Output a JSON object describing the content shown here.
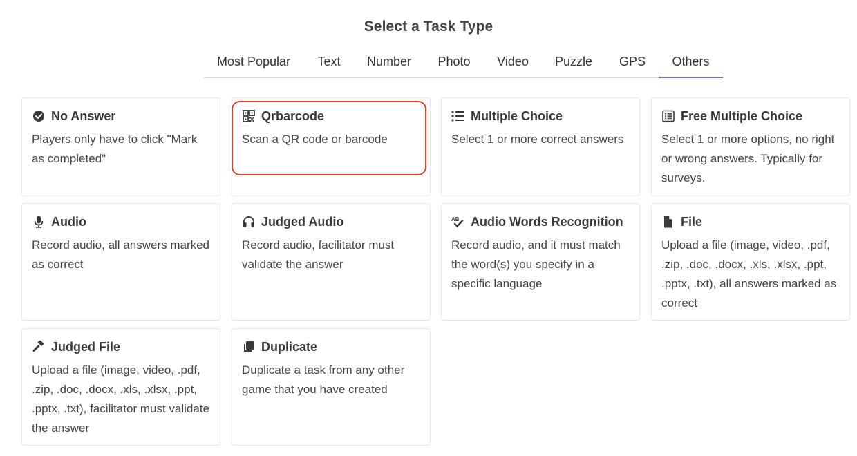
{
  "page": {
    "title": "Select a Task Type"
  },
  "tabs": [
    {
      "label": "Most Popular",
      "active": false
    },
    {
      "label": "Text",
      "active": false
    },
    {
      "label": "Number",
      "active": false
    },
    {
      "label": "Photo",
      "active": false
    },
    {
      "label": "Video",
      "active": false
    },
    {
      "label": "Puzzle",
      "active": false
    },
    {
      "label": "GPS",
      "active": false
    },
    {
      "label": "Others",
      "active": true
    }
  ],
  "cards": [
    {
      "title": "No Answer",
      "description": "Players only have to click \"Mark as completed\"",
      "icon": "check-circle-icon"
    },
    {
      "title": "Qrbarcode",
      "description": "Scan a QR code or barcode",
      "icon": "qrcode-icon",
      "highlighted": true
    },
    {
      "title": "Multiple Choice",
      "description": "Select 1 or more correct answers",
      "icon": "list-icon"
    },
    {
      "title": "Free Multiple Choice",
      "description": "Select 1 or more options, no right or wrong answers. Typically for surveys.",
      "icon": "list-box-icon"
    },
    {
      "title": "Audio",
      "description": "Record audio, all answers marked as correct",
      "icon": "microphone-icon"
    },
    {
      "title": "Judged Audio",
      "description": "Record audio, facilitator must validate the answer",
      "icon": "headphones-icon"
    },
    {
      "title": "Audio Words Recognition",
      "description": "Record audio, and it must match the word(s) you specify in a specific language",
      "icon": "spellcheck-icon"
    },
    {
      "title": "File",
      "description": "Upload a file (image, video, .pdf, .zip, .doc, .docx, .xls, .xlsx, .ppt, .pptx, .txt), all answers marked as correct",
      "icon": "file-icon"
    },
    {
      "title": "Judged File",
      "description": "Upload a file (image, video, .pdf, .zip, .doc, .docx, .xls, .xlsx, .ppt, .pptx, .txt), facilitator must validate the answer",
      "icon": "gavel-icon"
    },
    {
      "title": "Duplicate",
      "description": "Duplicate a task from any other game that you have created",
      "icon": "clone-icon"
    }
  ],
  "colors": {
    "active_tab_underline": "#6a6fb8",
    "highlight_border": "#d9412e",
    "text": "#3a3a3a"
  }
}
